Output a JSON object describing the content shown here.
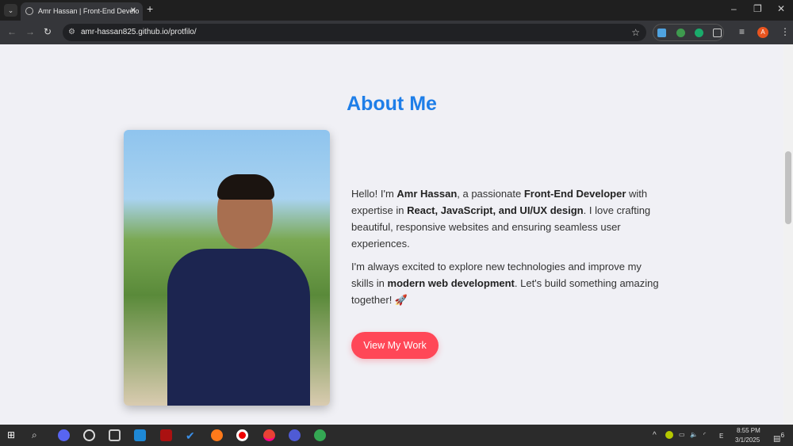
{
  "browser": {
    "tab_title": "Amr Hassan | Front-End Develo",
    "url": "amr-hassan825.github.io/protfilo/",
    "profile_initial": "A"
  },
  "page": {
    "title": "About Me",
    "paragraph1": [
      {
        "t": "Hello! I'm ",
        "b": false
      },
      {
        "t": "Amr Hassan",
        "b": true
      },
      {
        "t": ", a passionate ",
        "b": false
      },
      {
        "t": "Front-End Developer",
        "b": true
      },
      {
        "t": " with expertise in ",
        "b": false
      },
      {
        "t": "React, JavaScript, and UI/UX design",
        "b": true
      },
      {
        "t": ". I love crafting beautiful, responsive websites and ensuring seamless user experiences.",
        "b": false
      }
    ],
    "paragraph2": [
      {
        "t": "I'm always excited to explore new technologies and improve my skills in ",
        "b": false
      },
      {
        "t": "modern web development",
        "b": true
      },
      {
        "t": ". Let's build something amazing together! 🚀",
        "b": false
      }
    ],
    "cta": "View My Work"
  },
  "taskbar": {
    "time": "8:55 PM",
    "date": "3/1/2025",
    "notifications": "6",
    "lang": "E"
  },
  "colors": {
    "accent": "#1e7ee8",
    "button": "#ff4757"
  }
}
